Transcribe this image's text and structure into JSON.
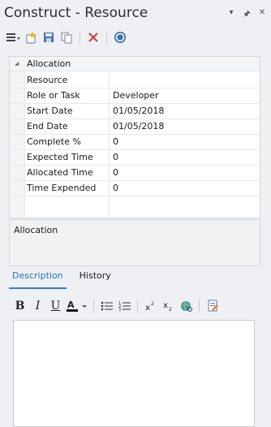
{
  "window": {
    "title": "Construct - Resource"
  },
  "window_buttons": [
    "▾",
    "🖈",
    "✕"
  ],
  "properties": {
    "category": "Allocation",
    "rows": [
      {
        "name": "Resource",
        "value": ""
      },
      {
        "name": "Role or Task",
        "value": "Developer"
      },
      {
        "name": "Start Date",
        "value": "01/05/2018"
      },
      {
        "name": "End Date",
        "value": "01/05/2018"
      },
      {
        "name": "Complete %",
        "value": "0"
      },
      {
        "name": "Expected Time",
        "value": "0"
      },
      {
        "name": "Allocated Time",
        "value": "0"
      },
      {
        "name": "Time Expended",
        "value": "0"
      }
    ]
  },
  "description_panel": {
    "label": "Allocation"
  },
  "tabs": [
    {
      "label": "Description",
      "active": true
    },
    {
      "label": "History",
      "active": false
    }
  ],
  "format_toolbar": {
    "bold": "B",
    "italic": "I",
    "underline": "U"
  },
  "colors": {
    "accent": "#2a6fb8",
    "delete": "#d23b3b"
  }
}
